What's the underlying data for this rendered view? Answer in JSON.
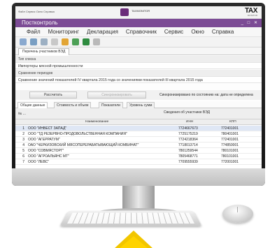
{
  "topbar": {
    "small_menu": "Файл  Сервис  Окно  Справка",
    "center_text": "TAXMONITOR",
    "brand": "TAX",
    "brand_sub": "MONITOR"
  },
  "window": {
    "title": "Постконтроль",
    "controls": "_ □ ✕"
  },
  "menu": [
    "Файл",
    "Мониторинг",
    "Декларация",
    "Справочник",
    "Сервис",
    "Окно",
    "Справка"
  ],
  "toolbar_icons": [
    {
      "name": "open-icon",
      "color": "#8aa9cf"
    },
    {
      "name": "save-icon",
      "color": "#7a9fc3"
    },
    {
      "name": "print-icon",
      "color": "#9db0c3"
    },
    {
      "name": "delete-icon",
      "color": "#c8c8c8"
    },
    {
      "name": "export-icon",
      "color": "#e2a535"
    },
    {
      "name": "refresh-icon",
      "color": "#4da056"
    },
    {
      "name": "excel-icon",
      "color": "#2e8b3f"
    },
    {
      "name": "filter-icon",
      "color": "#b9b9b9"
    }
  ],
  "main_tab": "Перечень участников ВЭД",
  "list_type_label": "Тип списка",
  "list_type_value": "Импортеры мясной промышленности",
  "period_label": "Сравнение периодов",
  "period_value": "Сравнение значений показателей IV квартала 2015 года со значениями показателей III квартала 2015 года",
  "actions": {
    "calc": "Рассчитать",
    "sync": "Синхронизировать",
    "sync_status": "Синхронизировано по состоянию на:  дата не определена"
  },
  "subtabs": [
    "Общие данные",
    "Стоимость и объем",
    "Показатели",
    "Уровень сумм"
  ],
  "grid": {
    "num_header": "№ ...",
    "group_header": "Сведения об участнике ВЭД",
    "columns": {
      "name": "Наименование",
      "inn": "ИНН",
      "kpp": "КПП"
    },
    "rows": [
      {
        "n": "1",
        "name": "ООО \"ИНВЕСТ ЗАПАД\"",
        "inn": "7724667673",
        "kpp": "772401001"
      },
      {
        "n": "2",
        "name": "ООО \"ТД РЕЗЕРВНО-ПРОДОВОЛЬСТВЕННАЯ КОМПАНИЯ\"",
        "inn": "7725175219",
        "kpp": "780401001"
      },
      {
        "n": "3",
        "name": "ООО \"АГЕРРАТУМ\"",
        "inn": "7724218364",
        "kpp": "772401001"
      },
      {
        "n": "4",
        "name": "ОАО \"ЧЕРКИЗОВСКИЙ МЯСОПЕРЕРАБАТЫВАЮЩИЙ КОМБИНАТ\"",
        "inn": "7718013714",
        "kpp": "774850001"
      },
      {
        "n": "5",
        "name": "ООО \"СОВМЯСТОРГ\"",
        "inn": "7801259544",
        "kpp": "780101001"
      },
      {
        "n": "6",
        "name": "ООО \"АГРОАЛЬЯНС МТ\"",
        "inn": "7805468771",
        "kpp": "780101001"
      },
      {
        "n": "7",
        "name": "ООО \"ЛЕВС\"",
        "inn": "7709555939",
        "kpp": "772001001"
      }
    ]
  }
}
